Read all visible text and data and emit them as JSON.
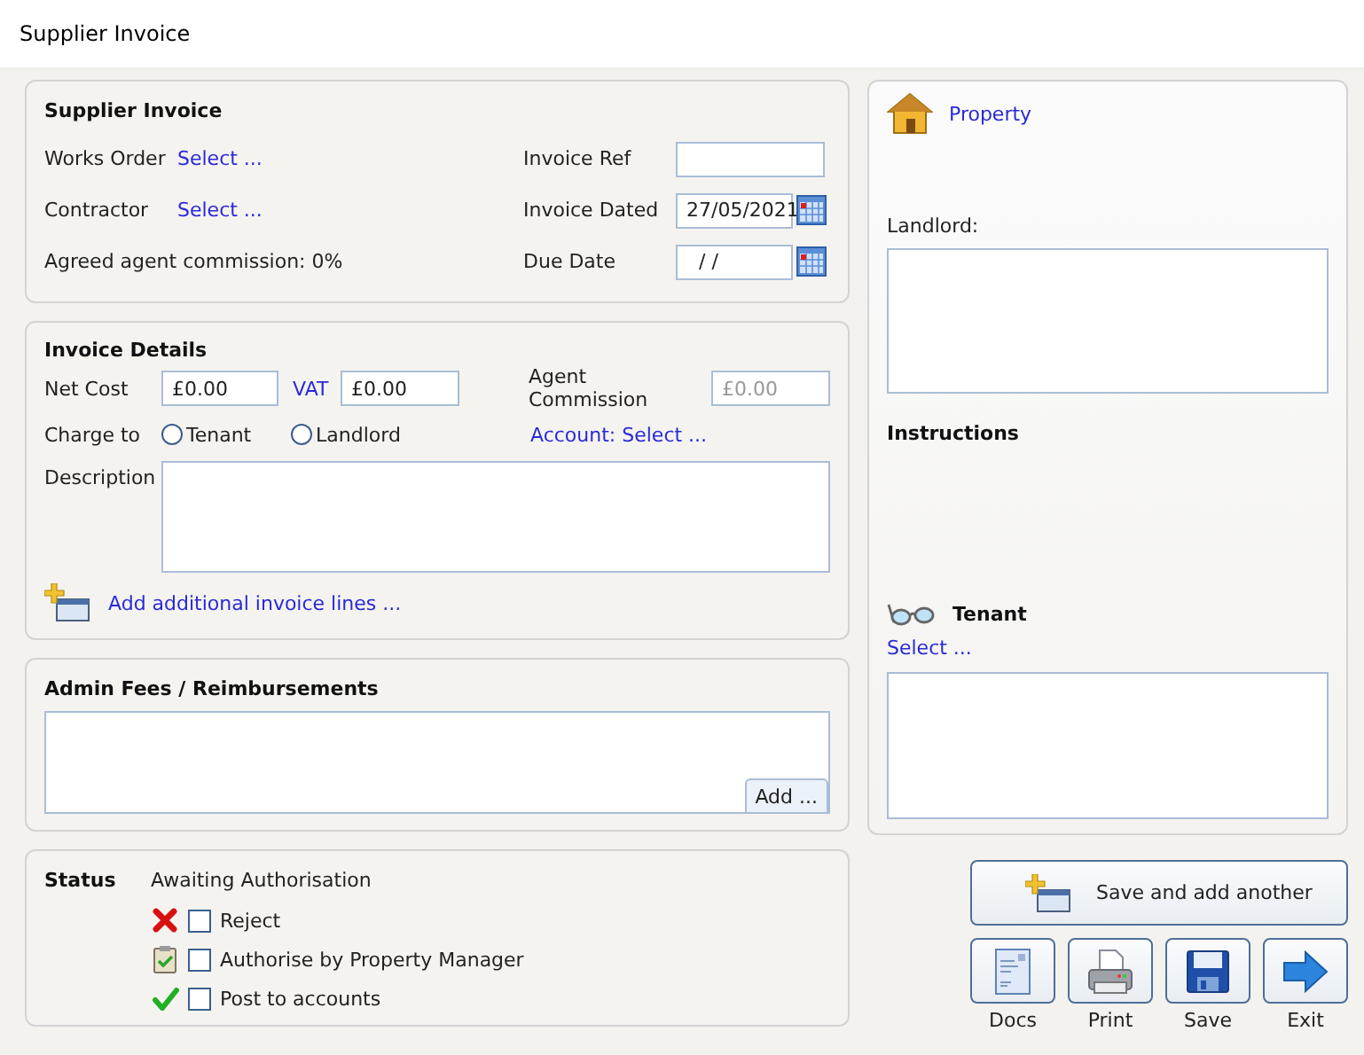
{
  "window": {
    "title": "Supplier Invoice"
  },
  "supplier_invoice": {
    "heading": "Supplier Invoice",
    "works_order": {
      "label": "Works Order",
      "link": "Select ..."
    },
    "contractor": {
      "label": "Contractor",
      "link": "Select ..."
    },
    "commission_note": "Agreed agent commission: 0%",
    "invoice_ref": {
      "label": "Invoice Ref"
    },
    "invoice_dated": {
      "label": "Invoice Dated",
      "value": "27/05/2021"
    },
    "due_date": {
      "label": "Due Date",
      "value": "/ /"
    }
  },
  "invoice_details": {
    "heading": "Invoice Details",
    "net_cost": {
      "label": "Net Cost",
      "value": "£0.00"
    },
    "vat": {
      "label": "VAT",
      "value": "£0.00"
    },
    "agent_commission": {
      "label": "Agent Commission",
      "value": "£0.00",
      "disabled": true
    },
    "charge_to": {
      "label": "Charge to",
      "options": [
        {
          "label": "Tenant",
          "selected": false
        },
        {
          "label": "Landlord",
          "selected": false
        }
      ]
    },
    "account_link": "Account: Select ...",
    "description": {
      "label": "Description"
    },
    "add_lines_link": "Add additional invoice lines ..."
  },
  "admin_fees": {
    "heading": "Admin Fees / Reimbursements",
    "add_button": "Add ..."
  },
  "status": {
    "heading": "Status",
    "value": "Awaiting Authorisation",
    "actions": [
      {
        "kind": "reject",
        "label": "Reject",
        "checked": false
      },
      {
        "kind": "authorise",
        "label": "Authorise by Property Manager",
        "checked": false
      },
      {
        "kind": "post",
        "label": "Post to accounts",
        "checked": false
      }
    ]
  },
  "property": {
    "link": "Property",
    "landlord_label": "Landlord:",
    "instructions_heading": "Instructions",
    "tenant_heading": "Tenant",
    "tenant_link": "Select ..."
  },
  "save_and_add_button": "Save and add another",
  "toolbar": [
    {
      "kind": "docs",
      "label": "Docs"
    },
    {
      "kind": "print",
      "label": "Print"
    },
    {
      "kind": "save",
      "label": "Save"
    },
    {
      "kind": "exit",
      "label": "Exit"
    }
  ]
}
